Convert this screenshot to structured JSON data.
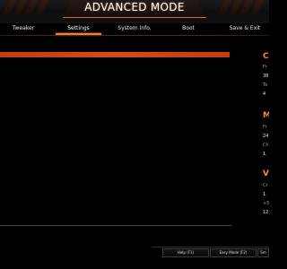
{
  "header": {
    "title": "ADVANCED MODE",
    "accent_color": "#e26c2d"
  },
  "tabs": {
    "items": [
      {
        "label": "Tweaker",
        "active": false
      },
      {
        "label": "Settings",
        "active": true
      },
      {
        "label": "System Info.",
        "active": false
      },
      {
        "label": "Boot",
        "active": false
      },
      {
        "label": "Save & Exit",
        "active": false
      }
    ]
  },
  "main": {
    "highlight_color": "#d84a1d"
  },
  "info_panel": {
    "sections": [
      {
        "heading": "C",
        "lines": [
          "Fr",
          "38",
          "Te",
          "4"
        ]
      },
      {
        "heading": "M",
        "lines": [
          "Fr",
          "24",
          "Ch",
          "1."
        ]
      },
      {
        "heading": "V",
        "lines": [
          "Cr",
          "1.",
          "+5",
          "12"
        ]
      }
    ]
  },
  "footer": {
    "buttons": [
      {
        "label": "Help (F1)"
      },
      {
        "label": "Easy Mode (F2)"
      },
      {
        "label": "Sm"
      }
    ]
  }
}
